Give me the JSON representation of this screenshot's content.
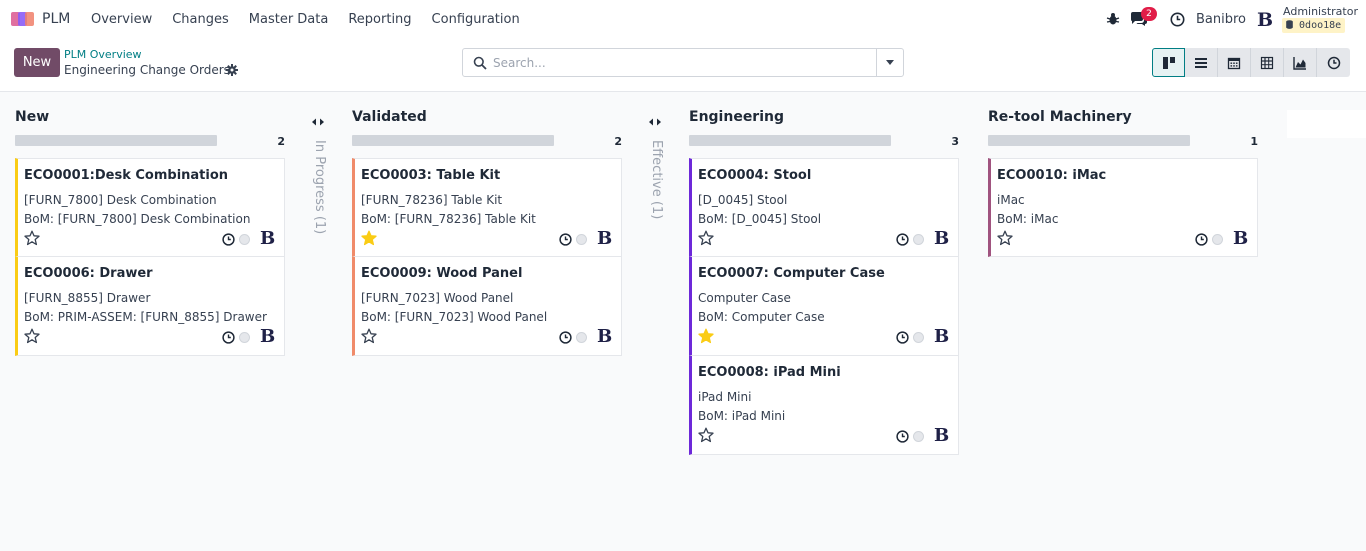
{
  "navbar": {
    "app_name": "PLM",
    "menu": [
      "Overview",
      "Changes",
      "Master Data",
      "Reporting",
      "Configuration"
    ],
    "chat_count": "2",
    "company": "Banibro",
    "user_name": "Administrator",
    "db_name": "0doo18e",
    "icons": [
      "bug-icon",
      "chat-icon",
      "clock-icon",
      "company-logo"
    ]
  },
  "control": {
    "new_label": "New",
    "breadcrumb_parent": "PLM Overview",
    "breadcrumb_current": "Engineering Change Orders",
    "search_placeholder": "Search...",
    "views": [
      "kanban-icon",
      "list-icon",
      "calendar-icon",
      "pivot-icon",
      "graph-icon",
      "activity-icon"
    ]
  },
  "columns": [
    {
      "title": "New",
      "count": "2",
      "cards": [
        {
          "title": "ECO0001:Desk Combination",
          "product": "[FURN_7800] Desk Combination",
          "bom": "BoM: [FURN_7800] Desk Combination",
          "starred": false,
          "color": "#facc15"
        },
        {
          "title": "ECO0006: Drawer",
          "product": "[FURN_8855] Drawer",
          "bom": "BoM: PRIM-ASSEM: [FURN_8855] Drawer",
          "starred": false,
          "color": "#facc15"
        }
      ]
    },
    {
      "title": "Validated",
      "count": "2",
      "cards": [
        {
          "title": "ECO0003: Table Kit",
          "product": "[FURN_78236] Table Kit",
          "bom": "BoM: [FURN_78236] Table Kit",
          "starred": true,
          "color": "#f08b6a"
        },
        {
          "title": "ECO0009: Wood Panel",
          "product": "[FURN_7023] Wood Panel",
          "bom": "BoM: [FURN_7023] Wood Panel",
          "starred": false,
          "color": "#f08b6a"
        }
      ]
    },
    {
      "title": "Engineering",
      "count": "3",
      "cards": [
        {
          "title": "ECO0004: Stool",
          "product": "[D_0045] Stool",
          "bom": "BoM: [D_0045] Stool",
          "starred": false,
          "color": "#6d28d9"
        },
        {
          "title": "ECO0007: Computer Case",
          "product": "Computer Case",
          "bom": "BoM: Computer Case",
          "starred": true,
          "color": "#6d28d9"
        },
        {
          "title": "ECO0008: iPad Mini",
          "product": "iPad Mini",
          "bom": "BoM: iPad Mini",
          "starred": false,
          "color": "#6d28d9"
        }
      ]
    },
    {
      "title": "Re-tool Machinery",
      "count": "1",
      "cards": [
        {
          "title": "ECO0010: iMac",
          "product": "iMac",
          "bom": "BoM: iMac",
          "starred": false,
          "color": "#a0537f"
        }
      ]
    }
  ],
  "folded": [
    {
      "label": "In Progress (1)"
    },
    {
      "label": "Effective (1)"
    }
  ],
  "card_avatar": "B",
  "colors": {
    "accent": "#714b67",
    "teal": "#017e84",
    "star_filled": "#facc15"
  }
}
